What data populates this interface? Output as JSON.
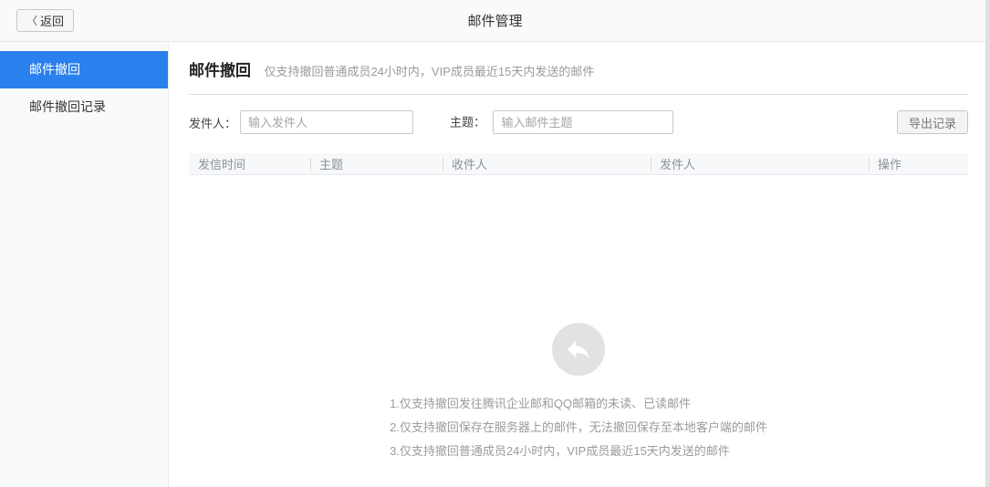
{
  "topbar": {
    "back_icon": "〈",
    "back_label": "返回",
    "title": "邮件管理"
  },
  "sidebar": {
    "items": [
      {
        "label": "邮件撤回",
        "active": true
      },
      {
        "label": "邮件撤回记录",
        "active": false
      }
    ]
  },
  "main": {
    "section_title": "邮件撤回",
    "section_subtitle": "仅支持撤回普通成员24小时内，VIP成员最近15天内发送的邮件",
    "filters": {
      "sender_label": "发件人：",
      "sender_placeholder": "输入发件人",
      "sender_value": "",
      "subject_label": "主题：",
      "subject_placeholder": "输入邮件主题",
      "subject_value": "",
      "export_button": "导出记录"
    },
    "table": {
      "columns": [
        "发信时间",
        "主题",
        "收件人",
        "发件人",
        "操作"
      ],
      "rows": []
    },
    "empty": {
      "icon": "recall-reply-arrow",
      "tips": [
        "1.仅支持撤回发往腾讯企业邮和QQ邮箱的未读、已读邮件",
        "2.仅支持撤回保存在服务器上的邮件，无法撤回保存至本地客户端的邮件",
        "3.仅支持撤回普通成员24小时内，VIP成员最近15天内发送的邮件"
      ]
    }
  },
  "colors": {
    "accent_blue": "#2a80ec",
    "topbar_bg": "#fafafa",
    "sidebar_bg": "#f9fafb",
    "empty_icon_gray": "#e2e2e2"
  }
}
